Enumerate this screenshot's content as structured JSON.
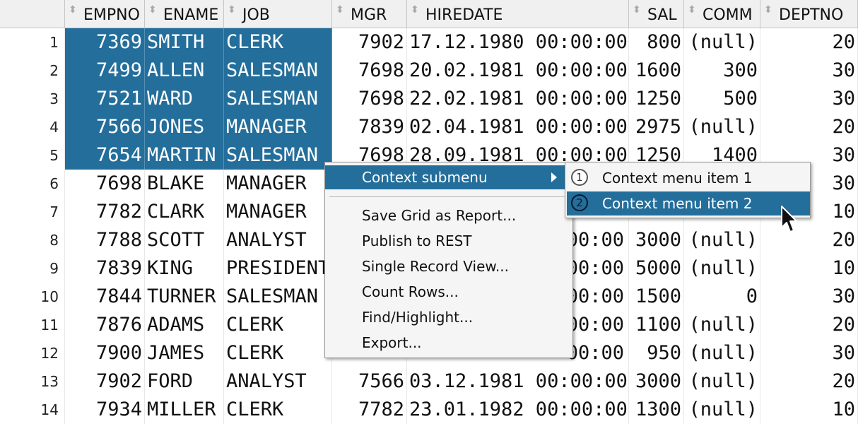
{
  "columns": [
    "EMPNO",
    "ENAME",
    "JOB",
    "MGR",
    "HIREDATE",
    "SAL",
    "COMM",
    "DEPTNO"
  ],
  "rows": [
    {
      "num": "1",
      "empno": "7369",
      "ename": "SMITH",
      "job": "CLERK",
      "mgr": "7902",
      "hiredate": "17.12.1980 00:00:00",
      "sal": "800",
      "comm": "(null)",
      "deptno": "20"
    },
    {
      "num": "2",
      "empno": "7499",
      "ename": "ALLEN",
      "job": "SALESMAN",
      "mgr": "7698",
      "hiredate": "20.02.1981 00:00:00",
      "sal": "1600",
      "comm": "300",
      "deptno": "30"
    },
    {
      "num": "3",
      "empno": "7521",
      "ename": "WARD",
      "job": "SALESMAN",
      "mgr": "7698",
      "hiredate": "22.02.1981 00:00:00",
      "sal": "1250",
      "comm": "500",
      "deptno": "30"
    },
    {
      "num": "4",
      "empno": "7566",
      "ename": "JONES",
      "job": "MANAGER",
      "mgr": "7839",
      "hiredate": "02.04.1981 00:00:00",
      "sal": "2975",
      "comm": "(null)",
      "deptno": "20"
    },
    {
      "num": "5",
      "empno": "7654",
      "ename": "MARTIN",
      "job": "SALESMAN",
      "mgr": "7698",
      "hiredate": "28.09.1981 00:00:00",
      "sal": "1250",
      "comm": "1400",
      "deptno": "30"
    },
    {
      "num": "6",
      "empno": "7698",
      "ename": "BLAKE",
      "job": "MANAGER",
      "mgr": "",
      "hiredate": "",
      "sal": "",
      "comm": "",
      "deptno": "30"
    },
    {
      "num": "7",
      "empno": "7782",
      "ename": "CLARK",
      "job": "MANAGER",
      "mgr": "",
      "hiredate": "",
      "sal": "",
      "comm": "",
      "deptno": "10"
    },
    {
      "num": "8",
      "empno": "7788",
      "ename": "SCOTT",
      "job": "ANALYST",
      "mgr": "",
      "hiredate": "00:00",
      "sal": "3000",
      "comm": "(null)",
      "deptno": "20"
    },
    {
      "num": "9",
      "empno": "7839",
      "ename": "KING",
      "job": "PRESIDENT",
      "mgr": "",
      "hiredate": "00:00",
      "sal": "5000",
      "comm": "(null)",
      "deptno": "10"
    },
    {
      "num": "10",
      "empno": "7844",
      "ename": "TURNER",
      "job": "SALESMAN",
      "mgr": "",
      "hiredate": "00:00",
      "sal": "1500",
      "comm": "0",
      "deptno": "30"
    },
    {
      "num": "11",
      "empno": "7876",
      "ename": "ADAMS",
      "job": "CLERK",
      "mgr": "",
      "hiredate": "00:00",
      "sal": "1100",
      "comm": "(null)",
      "deptno": "20"
    },
    {
      "num": "12",
      "empno": "7900",
      "ename": "JAMES",
      "job": "CLERK",
      "mgr": "",
      "hiredate": "00:00",
      "sal": "950",
      "comm": "(null)",
      "deptno": "30"
    },
    {
      "num": "13",
      "empno": "7902",
      "ename": "FORD",
      "job": "ANALYST",
      "mgr": "7566",
      "hiredate": "03.12.1981 00:00:00",
      "sal": "3000",
      "comm": "(null)",
      "deptno": "20"
    },
    {
      "num": "14",
      "empno": "7934",
      "ename": "MILLER",
      "job": "CLERK",
      "mgr": "7782",
      "hiredate": "23.01.1982 00:00:00",
      "sal": "1300",
      "comm": "(null)",
      "deptno": "10"
    }
  ],
  "selected_rows": 5,
  "context_menu": {
    "submenu_label": "Context submenu",
    "items": [
      "Save Grid as Report...",
      "Publish to REST",
      "Single Record View...",
      "Count Rows...",
      "Find/Highlight...",
      "Export..."
    ]
  },
  "submenu": {
    "items": [
      {
        "badge": "1",
        "label": "Context menu item 1"
      },
      {
        "badge": "2",
        "label": "Context menu item 2"
      }
    ]
  },
  "colors": {
    "selection": "#246e9b",
    "header_bg": "#f0f0f0",
    "menu_bg": "#f5f5f5"
  },
  "icons": [
    "sort-arrows-icon",
    "submenu-arrow-icon",
    "mouse-pointer-icon"
  ]
}
